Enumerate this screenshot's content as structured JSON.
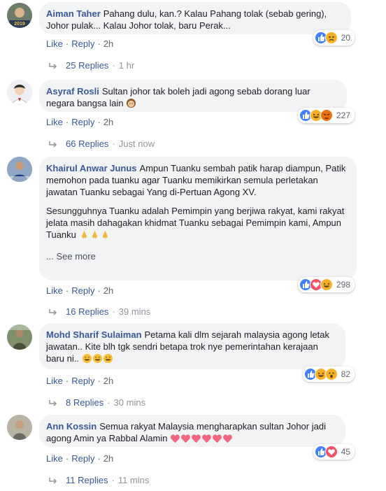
{
  "comments": [
    {
      "author": "Aiman Taher",
      "text": "Pahang dulu, kan.? Kalau Pahang tolak (sebab gering), Johor pulak... Kalau Johor tolak, baru Perak...",
      "like": "Like",
      "reply": "Reply",
      "time": "2h",
      "reaction_count": "20",
      "replies": "25 Replies",
      "replies_time": "1 hr",
      "avatar_label": "2019"
    },
    {
      "author": "Asyraf Rosli",
      "text": "Sultan johor tak boleh jadi agong sebab dorang luar negara bangsa lain",
      "like": "Like",
      "reply": "Reply",
      "time": "2h",
      "reaction_count": "227",
      "replies": "66 Replies",
      "replies_time": "Just now"
    },
    {
      "author": "Khairul Anwar Junus",
      "text": "Ampun Tuanku sembah patik harap diampun, Patik memohon pada tuanku agar Tuanku memikirkan semula perletakan jawatan Tuanku sebagai Yang di-Pertuan Agong XV.",
      "text2": "Sesungguhnya Tuanku adalah Pemimpin yang berjiwa rakyat, kami rakyat jelata masih dahagakan khidmat Tuanku sebagai Pemimpin kami, Ampun Tuanku",
      "see_more_prefix": "...",
      "see_more": "See more",
      "like": "Like",
      "reply": "Reply",
      "time": "2h",
      "reaction_count": "298",
      "replies": "16 Replies",
      "replies_time": "39 mins"
    },
    {
      "author": "Mohd Sharif Sulaiman",
      "text": "Petama kali dlm sejarah malaysia agong letak jawatan.. Kite blh tgk sendri betapa trok nye pemerintahan kerajaan baru ni..",
      "like": "Like",
      "reply": "Reply",
      "time": "2h",
      "reaction_count": "82",
      "replies": "8 Replies",
      "replies_time": "30 mins"
    },
    {
      "author": "Ann Kossin",
      "text": "Semua rakyat Malaysia mengharapkan sultan Johor jadi agong Amin ya Rabbal Alamin",
      "like": "Like",
      "reply": "Reply",
      "time": "2h",
      "reaction_count": "45",
      "replies": "11 Replies",
      "replies_time": "11 mins"
    }
  ],
  "colors": {
    "author": "#385898",
    "bubble": "#f2f3f5",
    "meta": "#606770",
    "like_reaction": "#4080ff",
    "love_reaction": "#f25268",
    "haha_reaction": "#f7b125",
    "angry_reaction": "#e9710f"
  },
  "icons": [
    "reply-arrow-icon",
    "like-reaction-icon",
    "love-reaction-icon",
    "haha-reaction-icon",
    "angry-reaction-icon",
    "wow-reaction-icon",
    "sad-reaction-icon",
    "grinning-emoji",
    "heart-emoji",
    "folded-hands-emoji"
  ]
}
